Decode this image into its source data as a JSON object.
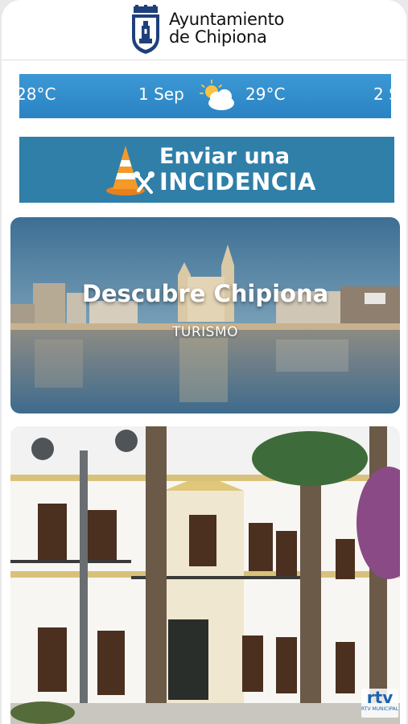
{
  "header": {
    "brand_line1": "Ayuntamiento",
    "brand_line2": "de Chipiona",
    "crest_icon": "coat-of-arms-icon"
  },
  "weather_ticker": {
    "left_temp": "28°C",
    "date": "1 Sep",
    "icon": "sun-behind-cloud-icon",
    "temp": "29°C",
    "next_date": "2 S"
  },
  "incidencia": {
    "line1": "Enviar una",
    "line2": "INCIDENCIA",
    "icon": "traffic-cone-tools-icon"
  },
  "cards": [
    {
      "title": "Descubre Chipiona",
      "subtitle": "TURISMO"
    },
    {
      "title": "",
      "subtitle": "",
      "watermark_big": "rtv",
      "watermark_small": "RTV MUNICIPAL"
    }
  ],
  "colors": {
    "ticker_bg": "#2a83c4",
    "banner_bg": "#2f7fa8",
    "crest_blue": "#1f3f7a"
  }
}
